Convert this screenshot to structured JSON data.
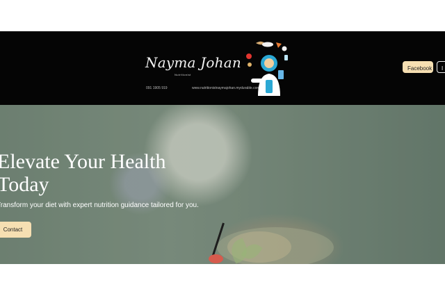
{
  "header": {
    "brand_name": "Nayma Johan",
    "brand_subtitle": "Nutritionist",
    "phone": "091 1905 919",
    "website": "www.nutritionistnaymajohan.mydurable.com"
  },
  "social": {
    "facebook_label": "Facebook",
    "next_label": "I"
  },
  "hero": {
    "title": "Elevate Your Health Today",
    "subtitle": "Transform your diet with expert nutrition guidance tailored for you.",
    "contact_label": "Contact"
  },
  "colors": {
    "header_bg": "#050505",
    "accent_button": "#f6dfb2",
    "hero_overlay": "#718474"
  },
  "icons": {
    "illustration": "nutritionist-illustration"
  }
}
